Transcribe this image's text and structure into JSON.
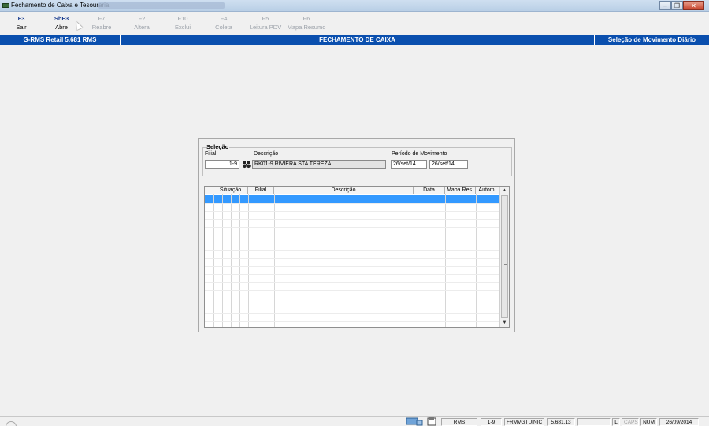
{
  "window": {
    "title": "Fechamento de Caixa e Tesouraria"
  },
  "toolbar": {
    "keys": [
      {
        "key": "F3",
        "label": "Sair"
      },
      {
        "key": "ShF3",
        "label": "Abre"
      },
      {
        "key": "F7",
        "label": "Reabre"
      },
      {
        "key": "F2",
        "label": "Altera"
      },
      {
        "key": "F10",
        "label": "Exclui"
      },
      {
        "key": "F4",
        "label": "Coleta"
      },
      {
        "key": "F5",
        "label": "Leitura PDV"
      },
      {
        "key": "F6",
        "label": "Mapa Resumo"
      }
    ]
  },
  "header": {
    "app": "G-RMS Retail 5.681 RMS",
    "screen": "FECHAMENTO DE CAIXA",
    "mode": "Seleção de Movimento Diário"
  },
  "selection": {
    "legend": "Seleção",
    "filial_label": "Filial",
    "filial_value": "1-9",
    "descricao_label": "Descrição",
    "descricao_value": "RK01-9 RIVIERA STA TEREZA",
    "periodo_label": "Período de Movimento",
    "periodo_inicio": "26/set/14",
    "periodo_fim": "26/set/14"
  },
  "grid": {
    "columns": [
      "Situação",
      "Filial",
      "Descrição",
      "Data",
      "Mapa Res.",
      "Autom."
    ],
    "rows": []
  },
  "statusbar": {
    "user": "RMS",
    "filial": "1-9",
    "form": "FRMVGTUINIC",
    "version": "5.681.13",
    "l": "L",
    "caps": "CAPS",
    "num": "NUM",
    "date": "26/09/2014"
  },
  "colors": {
    "header_bar": "#0a4fae",
    "selected_row": "#3399ff",
    "fkey_active": "#1a3d8f"
  }
}
